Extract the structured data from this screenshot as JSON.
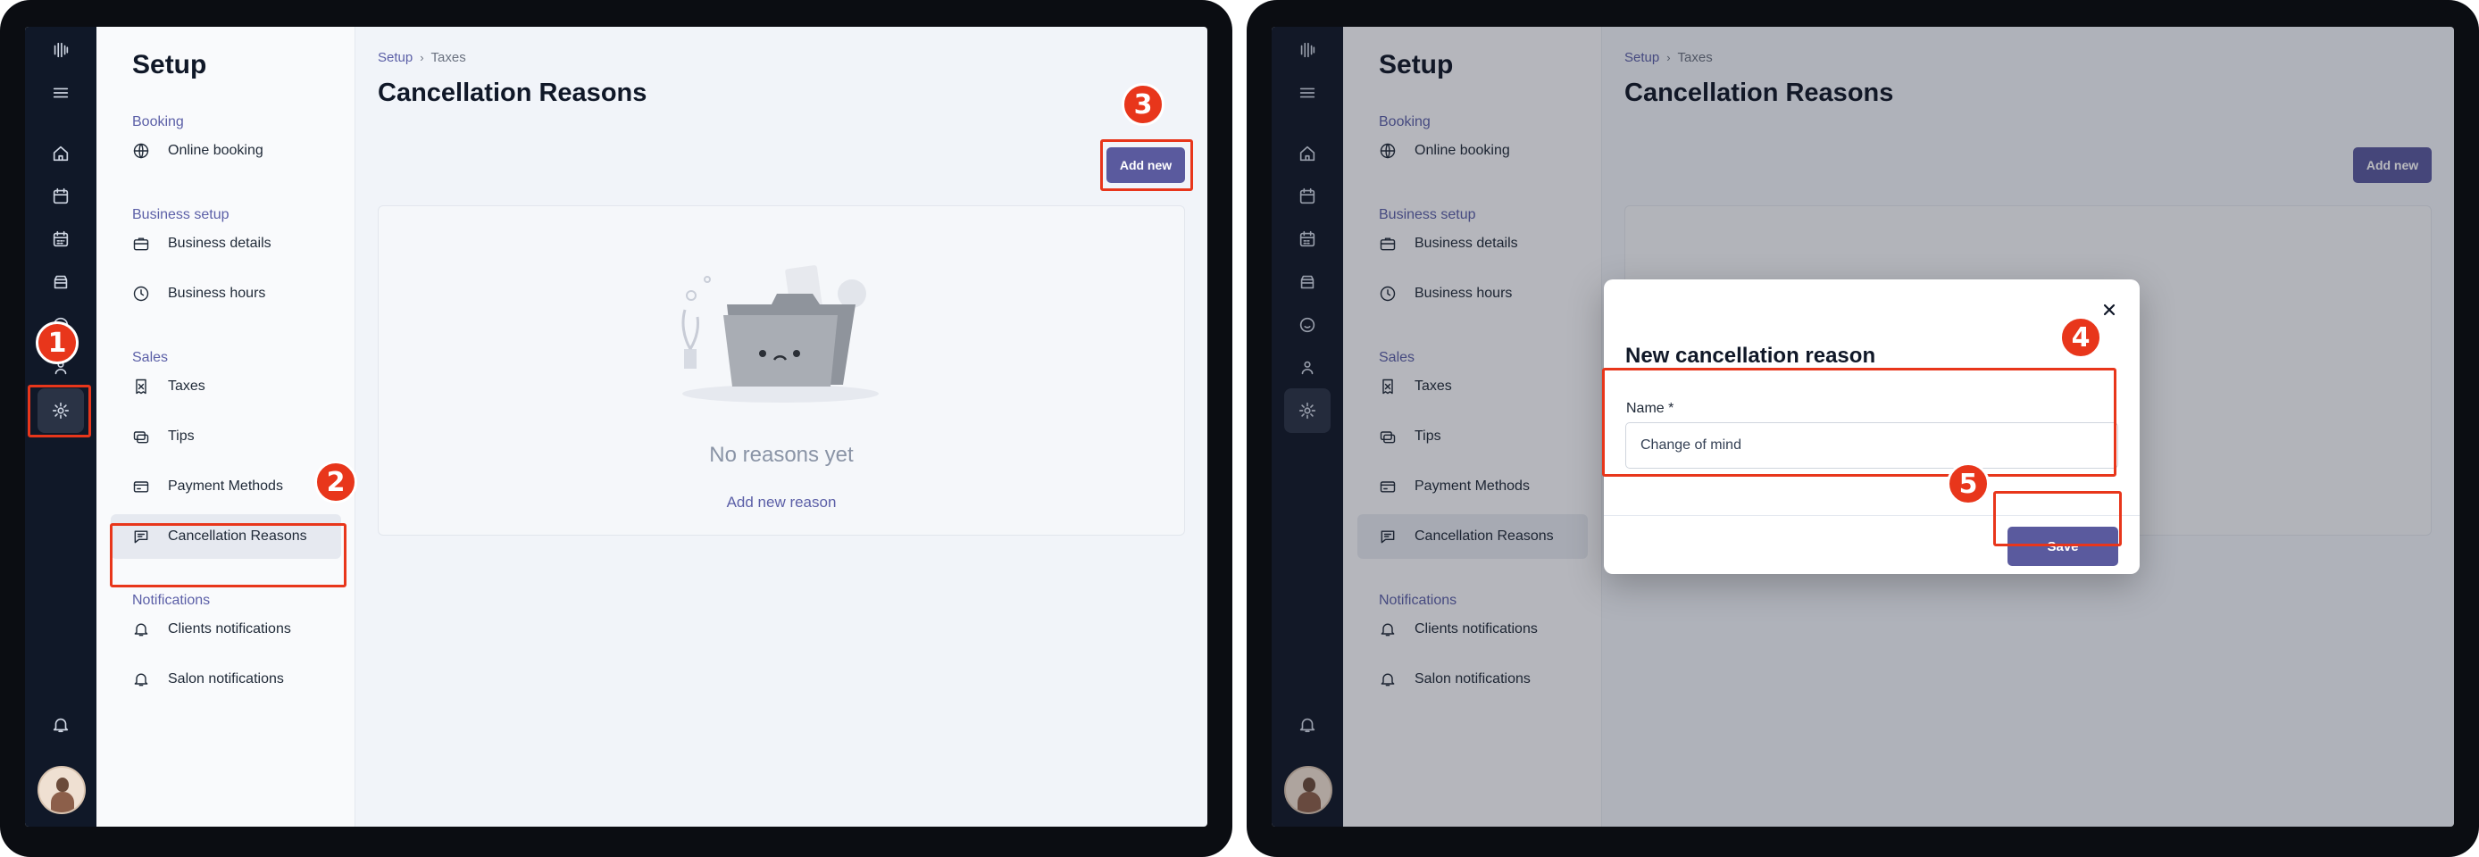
{
  "setup": {
    "title": "Setup",
    "sections": {
      "booking": "Booking",
      "business_setup": "Business setup",
      "sales": "Sales",
      "notifications": "Notifications"
    },
    "items": {
      "online_booking": "Online booking",
      "business_details": "Business details",
      "business_hours": "Business hours",
      "taxes": "Taxes",
      "tips": "Tips",
      "payment_methods": "Payment Methods",
      "cancellation_reasons": "Cancellation Reasons",
      "clients_notifications": "Clients notifications",
      "salon_notifications": "Salon notifications"
    }
  },
  "breadcrumb": {
    "root": "Setup",
    "current": "Taxes"
  },
  "page": {
    "title": "Cancellation Reasons",
    "add_button": "Add new"
  },
  "empty_state": {
    "text": "No reasons yet",
    "link": "Add new reason"
  },
  "modal": {
    "title": "New cancellation reason",
    "name_label": "Name *",
    "name_value": "Change of mind",
    "save_label": "Save"
  },
  "badges": [
    "1",
    "2",
    "3",
    "4",
    "5"
  ],
  "colors": {
    "accent": "#5a5a9e",
    "annotation": "#e8361b",
    "rail": "#101828"
  },
  "icons": [
    "logo-icon",
    "menu-icon",
    "home-icon",
    "calendar-icon",
    "calendar-grid-icon",
    "inventory-icon",
    "smile-icon",
    "team-icon",
    "gear-icon",
    "bell-icon",
    "globe-icon",
    "briefcase-icon",
    "clock-icon",
    "receipt-icon",
    "tips-icon",
    "card-icon",
    "message-icon",
    "close-icon"
  ]
}
